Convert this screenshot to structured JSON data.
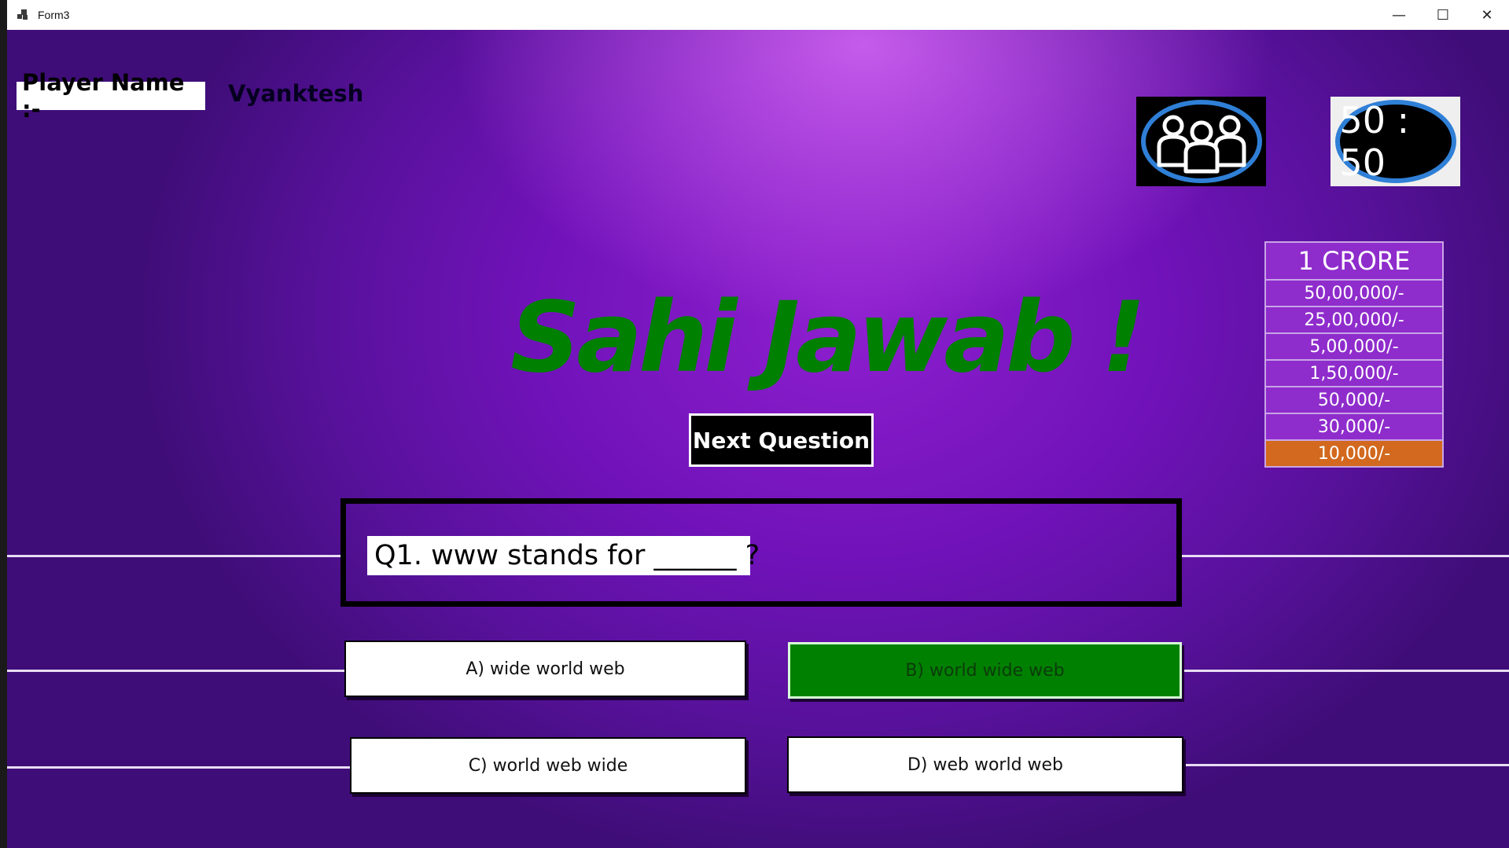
{
  "window": {
    "title": "Form3",
    "controls": {
      "minimize": "—",
      "maximize": "☐",
      "close": "✕"
    }
  },
  "player": {
    "label": "Player Name :-",
    "name": "Vyanktesh"
  },
  "lifelines": {
    "fifty_fifty": "50 : 50"
  },
  "prize_ladder": {
    "top": "1 CRORE",
    "levels": [
      "50,00,000/-",
      "25,00,000/-",
      "5,00,000/-",
      "1,50,000/-",
      "50,000/-",
      "30,000/-",
      "10,000/-"
    ],
    "current_level": "10,000/-"
  },
  "result": {
    "text": "Sahi Jawab !"
  },
  "next_button": {
    "label": "Next Question"
  },
  "question": {
    "text": "Q1. www stands for ______ ?"
  },
  "options": {
    "a": "A) wide world web",
    "b": "B) world wide web",
    "c": "C) world web wide",
    "d": "D) web world web",
    "selected_correct": "B) world wide web"
  },
  "colors": {
    "background": "#6a1aa8",
    "correct": "#008000",
    "current_prize": "#d2691e",
    "lifeline_ring": "#2f7fd6"
  },
  "icons": [
    "app-icon",
    "audience-poll-icon",
    "minimize-icon",
    "maximize-icon",
    "close-icon"
  ]
}
